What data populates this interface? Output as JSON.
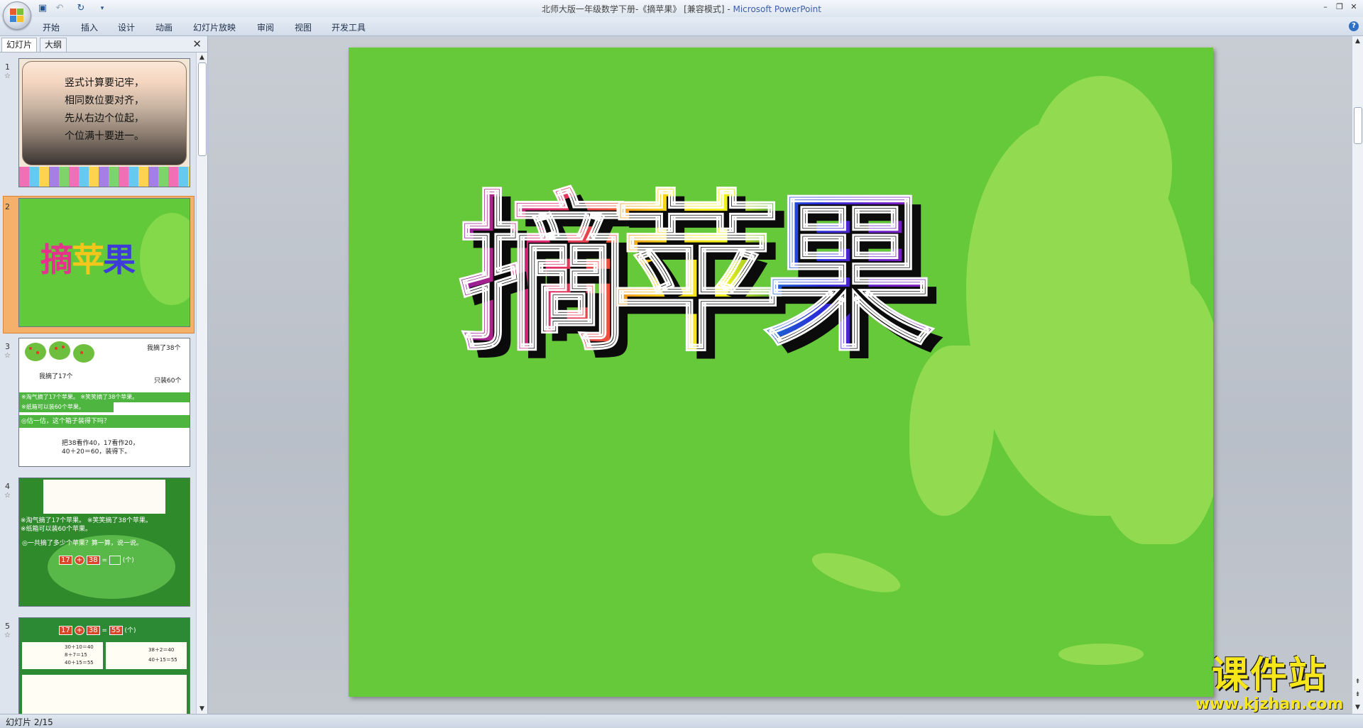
{
  "window": {
    "title_prefix": "北师大版一年级数学下册-《摘苹果》 [兼容模式] - ",
    "app_name": "Microsoft PowerPoint"
  },
  "quick_access": {
    "save_icon": "save-icon",
    "undo_icon": "undo-icon",
    "redo_icon": "redo-icon",
    "more": "▾"
  },
  "ribbon_tabs": [
    "开始",
    "插入",
    "设计",
    "动画",
    "幻灯片放映",
    "审阅",
    "视图",
    "开发工具"
  ],
  "panel": {
    "tabs": [
      "幻灯片",
      "大纲"
    ],
    "close": "✕",
    "slides": [
      {
        "num": "1",
        "lines": [
          "竖式计算要记牢，",
          "相同数位要对齐，",
          "先从右边个位起，",
          "个位满十要进一。"
        ]
      },
      {
        "num": "2",
        "title": [
          "摘",
          "苹",
          "果"
        ]
      },
      {
        "num": "3",
        "bubble1": "我摘了38个",
        "bubble2": "我摘了17个",
        "box_label": "只装60个",
        "band1": "※淘气摘了17个苹果。        ※笑笑摘了38个苹果。",
        "band2": "※纸箱可以装60个苹果。",
        "question": "◎估一估，这个箱子装得下吗？",
        "thought1": "把38看作40，17看作20，",
        "thought2": "40＋20＝60，装得下。"
      },
      {
        "num": "4",
        "band1": "※淘气摘了17个苹果。        ※笑笑摘了38个苹果。",
        "band2": "※纸箱可以装60个苹果。",
        "question": "◎一共摘了多少个苹果？算一算，说一说。",
        "eq_a": "17",
        "eq_op": "+",
        "eq_b": "38",
        "eq_eq": "=",
        "unit": "(个)"
      },
      {
        "num": "5",
        "eq_a": "17",
        "eq_op": "+",
        "eq_b": "38",
        "eq_eq": "=",
        "eq_r": "55",
        "unit": "(个)",
        "calc1": "30＋10＝40",
        "calc2": "8＋7＝15",
        "calc3": "40＋15＝55",
        "calc4": "38＋2＝40",
        "calc5": "40＋15＝55"
      }
    ]
  },
  "slide": {
    "title_chars": [
      "摘",
      "苹",
      "果"
    ]
  },
  "watermark": {
    "cn": "课件站",
    "url": "www.kjzhan.com"
  },
  "status": {
    "text": "幻灯片 2/15"
  },
  "colors": {
    "slide_bg": "#66c939",
    "splash": "#92db51",
    "watermark": "#f6e61a"
  }
}
